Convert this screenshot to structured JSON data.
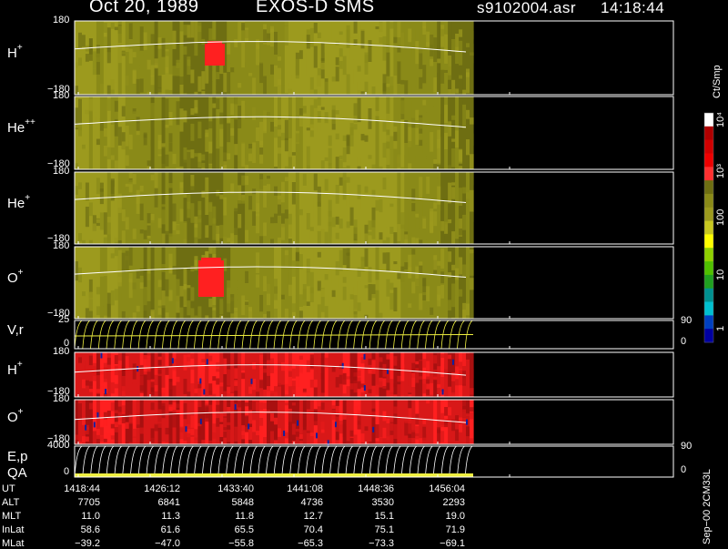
{
  "header": {
    "date": "Oct 20, 1989",
    "instrument": "EXOS-D SMS",
    "file": "s9102004.asr",
    "time": "14:18:44"
  },
  "colors": {
    "background": "#000000",
    "olive_light": "#9c9a1e",
    "olive_mid": "#8a8a18",
    "olive_dark": "#6e6e12",
    "red_bright": "#ff2020",
    "red_mid": "#d81818",
    "red_dark": "#a81010",
    "trace": "#ffffff",
    "qa_bar": "#f0f040"
  },
  "panels": [
    {
      "label": "H",
      "sup": "+",
      "ytop": "180",
      "ybot": "−180",
      "kind": "olive",
      "hot": true
    },
    {
      "label": "He",
      "sup": "++",
      "ytop": "180",
      "ybot": "−180",
      "kind": "olive",
      "hot": false
    },
    {
      "label": "He",
      "sup": "+",
      "ytop": "180",
      "ybot": "−180",
      "kind": "olive",
      "hot": false
    },
    {
      "label": "O",
      "sup": "+",
      "ytop": "180",
      "ybot": "−180",
      "kind": "olive",
      "hot": true
    },
    {
      "label": "V,r",
      "sup": "",
      "ytop": "25",
      "ybot": "0",
      "kind": "lines",
      "rtop": "90",
      "rbot": "0"
    },
    {
      "label": "H",
      "sup": "+",
      "ytop": "180",
      "ybot": "−180",
      "kind": "red"
    },
    {
      "label": "O",
      "sup": "+",
      "ytop": "180",
      "ybot": "−180",
      "kind": "red"
    },
    {
      "label": "E,p",
      "sup": "",
      "label2": "QA",
      "ytop": "4000",
      "ybot": "0",
      "kind": "lines",
      "rtop": "90",
      "rbot": "0"
    }
  ],
  "colorbar": {
    "unit": "Ct/Smp",
    "labels": [
      "10⁴",
      "10³",
      "100",
      "10",
      "1"
    ],
    "colors": [
      "#ffffff",
      "#b00000",
      "#d00000",
      "#ee0000",
      "#ff3030",
      "#6e6e12",
      "#8a8a18",
      "#9c9a1e",
      "#c8c820",
      "#ffff00",
      "#8fd000",
      "#50c000",
      "#20a020",
      "#009090",
      "#00c0d0",
      "#0040c0",
      "#0000a0"
    ]
  },
  "ephemeris": {
    "labels": [
      "UT",
      "ALT",
      "MLT",
      "InLat",
      "MLat"
    ],
    "columns": [
      [
        "1418:44",
        "7705",
        "11.0",
        "58.6",
        "−39.2"
      ],
      [
        "1426:12",
        "6841",
        "11.3",
        "61.6",
        "−47.0"
      ],
      [
        "1433:40",
        "5848",
        "11.8",
        "65.5",
        "−55.8"
      ],
      [
        "1441:08",
        "4736",
        "12.7",
        "70.4",
        "−65.3"
      ],
      [
        "1448:36",
        "3530",
        "15.1",
        "75.1",
        "−73.3"
      ],
      [
        "1456:04",
        "2293",
        "19.0",
        "71.9",
        "−69.1"
      ]
    ]
  },
  "footer_note": "Sep−00 2CM33L"
}
